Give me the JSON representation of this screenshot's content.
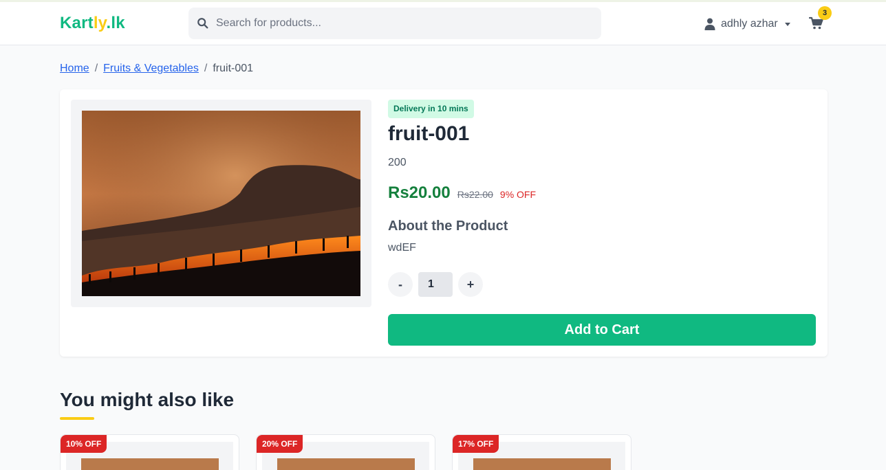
{
  "header": {
    "logo_part1": "Kart",
    "logo_part2": "ly",
    "logo_part3": ".lk",
    "search_placeholder": "Search for products...",
    "user_name": "adhly azhar",
    "cart_count": "3"
  },
  "breadcrumb": {
    "home": "Home",
    "sep1": "/",
    "category": "Fruits & Vegetables",
    "sep2": "/",
    "current": "fruit-001"
  },
  "product": {
    "delivery_badge": "Delivery in 10 mins",
    "title": "fruit-001",
    "weight": "200",
    "price": "Rs20.00",
    "old_price": "Rs22.00",
    "discount": "9% OFF",
    "about_heading": "About the Product",
    "about_text": "wdEF",
    "quantity": "1",
    "minus_label": "-",
    "plus_label": "+",
    "add_to_cart": "Add to Cart"
  },
  "related": {
    "heading": "You might also like",
    "items": [
      {
        "discount": "10% OFF"
      },
      {
        "discount": "20% OFF"
      },
      {
        "discount": "17% OFF"
      }
    ]
  },
  "colors": {
    "brand_green": "#10b981",
    "brand_yellow": "#facc15",
    "discount_red": "#dc2626",
    "price_green": "#15803d"
  }
}
